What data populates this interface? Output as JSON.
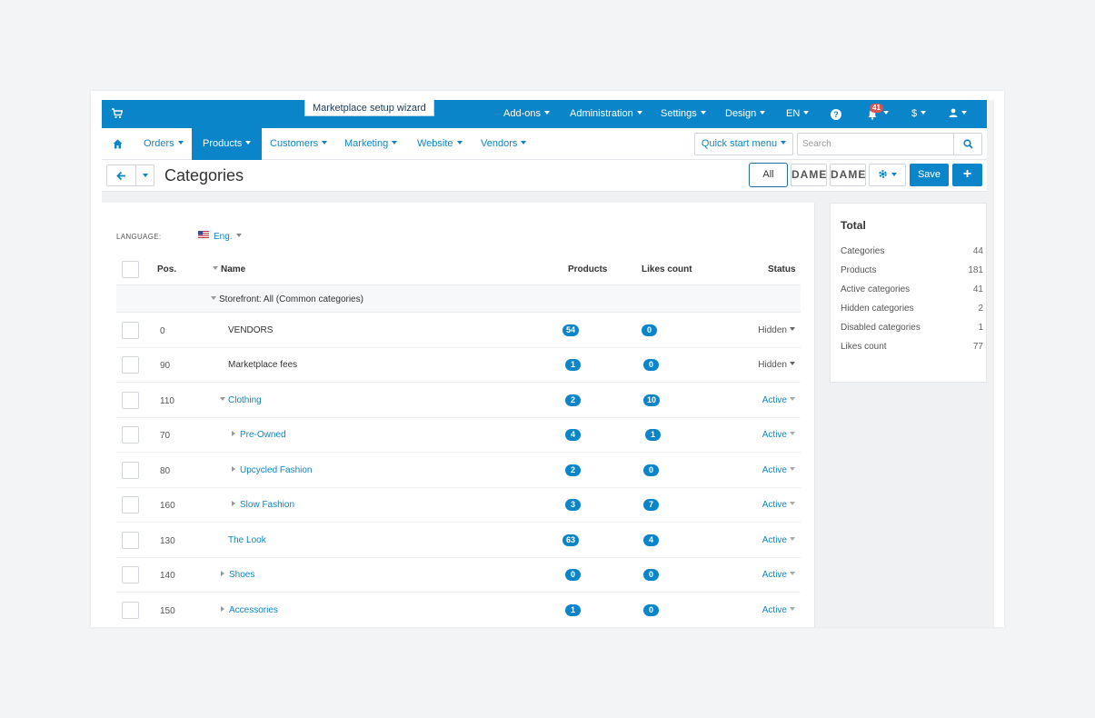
{
  "topbar": {
    "wizard": "Marketplace setup wizard",
    "menus": [
      "Add-ons",
      "Administration",
      "Settings",
      "Design",
      "EN"
    ],
    "notifications_count": "41",
    "currency": "$"
  },
  "nav": {
    "items": [
      "Orders",
      "Products",
      "Customers",
      "Marketing",
      "Website",
      "Vendors"
    ],
    "active": "Products",
    "quick_start": "Quick start menu",
    "search_placeholder": "Search"
  },
  "titlebar": {
    "title": "Categories",
    "all_label": "All",
    "ghost_1": "DAMEN",
    "ghost_2": "DAMEN",
    "save_label": "Save",
    "add_label": "+"
  },
  "filter": {
    "language_label": "LANGUAGE:",
    "language_value": "Eng."
  },
  "table": {
    "headers": {
      "pos": "Pos.",
      "name": "Name",
      "products": "Products",
      "likes": "Likes count",
      "status": "Status"
    },
    "group_label": "Storefront: All (Common categories)",
    "rows": [
      {
        "pos": "0",
        "name": "VENDORS",
        "products": "54",
        "likes": "0",
        "status": "Hidden",
        "type": "plain"
      },
      {
        "pos": "90",
        "name": "Marketplace fees",
        "products": "1",
        "likes": "0",
        "status": "Hidden",
        "type": "plain"
      },
      {
        "pos": "110",
        "name": "Clothing",
        "products": "2",
        "likes": "10",
        "status": "Active",
        "type": "link"
      },
      {
        "pos": "70",
        "name": "Pre-Owned",
        "products": "4",
        "likes": "1",
        "status": "Active",
        "type": "link"
      },
      {
        "pos": "80",
        "name": "Upcycled Fashion",
        "products": "2",
        "likes": "0",
        "status": "Active",
        "type": "link"
      },
      {
        "pos": "160",
        "name": "Slow Fashion",
        "products": "3",
        "likes": "7",
        "status": "Active",
        "type": "link"
      },
      {
        "pos": "130",
        "name": "The Look",
        "products": "63",
        "likes": "4",
        "status": "Active",
        "type": "link"
      },
      {
        "pos": "140",
        "name": "Shoes",
        "products": "0",
        "likes": "0",
        "status": "Active",
        "type": "link"
      },
      {
        "pos": "150",
        "name": "Accessories",
        "products": "1",
        "likes": "0",
        "status": "Active",
        "type": "link"
      }
    ]
  },
  "sidebar": {
    "title": "Total",
    "stats": [
      {
        "label": "Categories",
        "value": "44"
      },
      {
        "label": "Products",
        "value": "181"
      },
      {
        "label": "Active categories",
        "value": "41"
      },
      {
        "label": "Hidden categories",
        "value": "2"
      },
      {
        "label": "Disabled categories",
        "value": "1"
      },
      {
        "label": "Likes count",
        "value": "77"
      }
    ]
  },
  "colors": {
    "primary": "#0b85c9",
    "badge_alert": "#d9534f"
  },
  "icons": [
    "cart-icon",
    "home-icon",
    "help-icon",
    "bell-icon",
    "user-icon",
    "search-icon",
    "arrow-left-icon",
    "gear-icon",
    "flag-us-icon"
  ]
}
